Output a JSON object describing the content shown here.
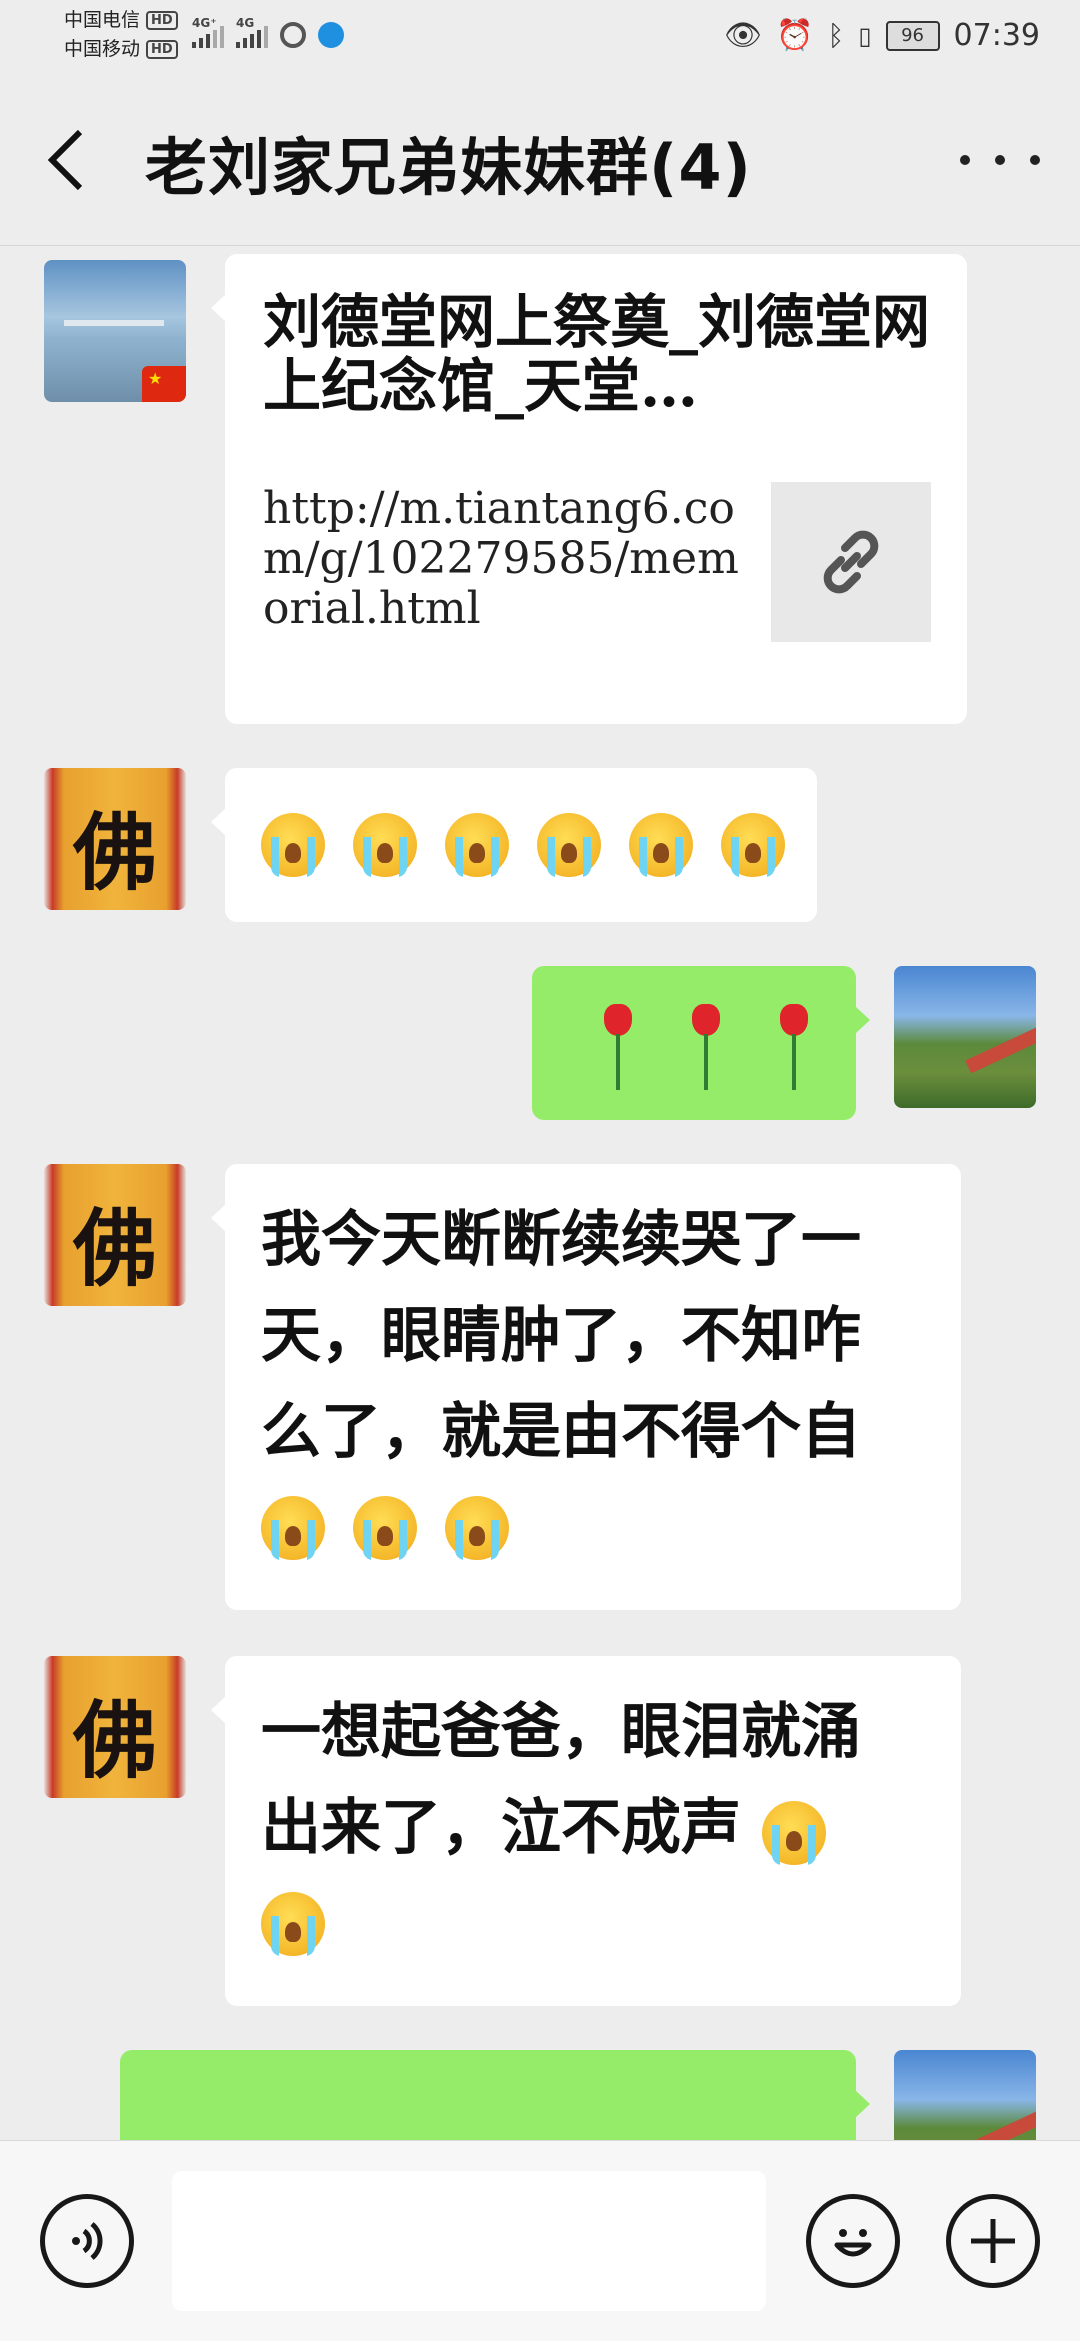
{
  "status_bar": {
    "carrier1": "中国电信",
    "carrier2": "中国移动",
    "hd_badge": "HD",
    "signal1_label": "4G⁺",
    "signal2_label": "4G",
    "battery": "96",
    "time": "07:39"
  },
  "header": {
    "title": "老刘家兄弟妹妹群(4)"
  },
  "messages": {
    "m1": {
      "type": "link",
      "title": "刘德堂网上祭奠_刘德堂网上纪念馆_天堂…",
      "url": "http://m.tiantang6.com/g/102279585/memorial.html"
    },
    "m2": {
      "type": "emoji",
      "emojis": [
        "loudly-crying-face",
        "loudly-crying-face",
        "loudly-crying-face",
        "loudly-crying-face",
        "loudly-crying-face",
        "loudly-crying-face"
      ]
    },
    "m3": {
      "type": "emoji",
      "emojis": [
        "rose",
        "rose",
        "rose"
      ]
    },
    "m4": {
      "line1": "我今天断断续续哭了一",
      "line2": "天，眼睛肿了，不知咋",
      "line3": "么了，就是由不得个自"
    },
    "m5": {
      "line1": "一想起爸爸，眼泪就涌",
      "line2": "出来了，泣不成声"
    }
  },
  "colors": {
    "background": "#ededed",
    "outgoing_bubble": "#95ec69",
    "incoming_bubble": "#ffffff"
  }
}
